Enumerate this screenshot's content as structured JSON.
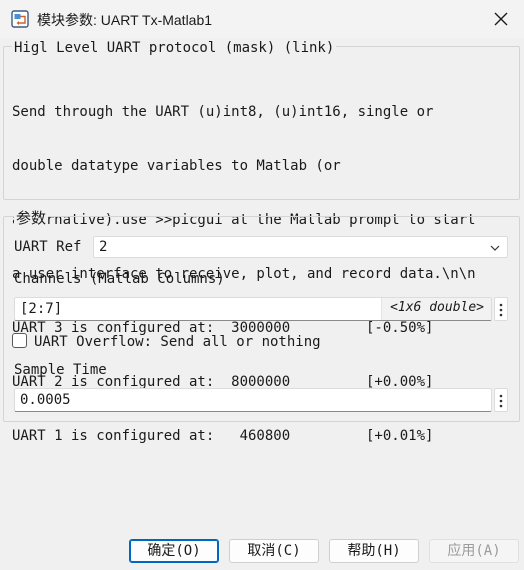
{
  "window": {
    "title": "模块参数: UART Tx-Matlab1",
    "icon": "simulink-block-icon",
    "close_icon": "close-icon"
  },
  "description": {
    "group_title": "Higl Level UART protocol (mask) (link)",
    "lines": [
      "Send through the UART (u)int8, (u)int16, single or",
      "double datatype variables to Matlab (or",
      "alternative).use >>picgui at the Matlab prompt to start",
      "a user interface to receive, plot, and record data.\\n\\n",
      "UART 3 is configured at:  3000000         [-0.50%]",
      "UART 2 is configured at:  8000000         [+0.00%]",
      "UART 1 is configured at:   460800         [+0.01%]"
    ]
  },
  "params": {
    "group_title": "参数",
    "uart_ref": {
      "label": "UART Ref",
      "value": "2"
    },
    "channels": {
      "label": "Channels (Matlab Columns)",
      "value": "[2:7]",
      "hint": "<1x6 double>"
    },
    "overflow": {
      "label": "UART Overflow: Send all or nothing",
      "checked": false
    },
    "sample_time": {
      "label": "Sample Time",
      "value": "0.0005"
    }
  },
  "buttons": {
    "ok": "确定(O)",
    "cancel": "取消(C)",
    "help": "帮助(H)",
    "apply": "应用(A)"
  }
}
